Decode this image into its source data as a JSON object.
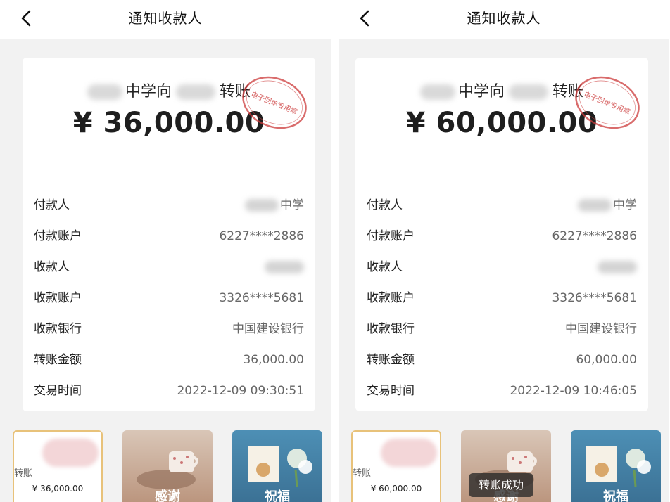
{
  "colors": {
    "background": "#f2f2f2",
    "card": "#ffffff",
    "seal": "#cc3b3b"
  },
  "left": {
    "nav_title": "通知收款人",
    "headline_a": "中学向",
    "headline_b": "转账",
    "amount": "¥ 36,000.00",
    "seal_text": "电子回单专用章",
    "rows": [
      {
        "label": "付款人",
        "value": "中学"
      },
      {
        "label": "付款账户",
        "value": "6227****2886"
      },
      {
        "label": "收款人",
        "value": ""
      },
      {
        "label": "收款账户",
        "value": "3326****5681"
      },
      {
        "label": "收款银行",
        "value": "中国建设银行"
      },
      {
        "label": "转账金额",
        "value": "36,000.00"
      },
      {
        "label": "交易时间",
        "value": "2022-12-09 09:30:51"
      }
    ],
    "thumbs": {
      "t1_text": "转账",
      "t1_amount": "¥ 36,000.00",
      "t2_text": "感谢",
      "t3_text": "祝福"
    }
  },
  "right": {
    "nav_title": "通知收款人",
    "headline_a": "中学向",
    "headline_b": "转账",
    "amount": "¥ 60,000.00",
    "seal_text": "电子回单专用章",
    "rows": [
      {
        "label": "付款人",
        "value": "中学"
      },
      {
        "label": "付款账户",
        "value": "6227****2886"
      },
      {
        "label": "收款人",
        "value": ""
      },
      {
        "label": "收款账户",
        "value": "3326****5681"
      },
      {
        "label": "收款银行",
        "value": "中国建设银行"
      },
      {
        "label": "转账金额",
        "value": "60,000.00"
      },
      {
        "label": "交易时间",
        "value": "2022-12-09 10:46:05"
      }
    ],
    "thumbs": {
      "t1_text": "转账",
      "t1_amount": "¥ 60,000.00",
      "t2_text": "感谢",
      "t3_text": "祝福"
    },
    "toast": "转账成功"
  }
}
